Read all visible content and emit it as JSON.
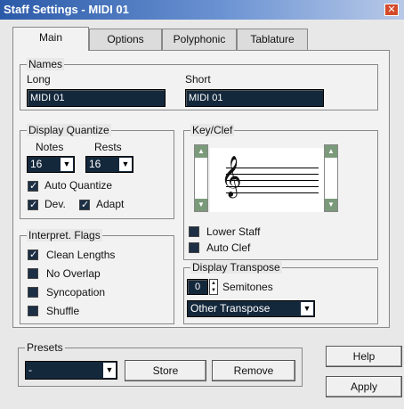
{
  "window": {
    "title": "Staff Settings - MIDI 01",
    "close_icon": "close-icon"
  },
  "tabs": [
    {
      "label": "Main",
      "active": true
    },
    {
      "label": "Options",
      "active": false
    },
    {
      "label": "Polyphonic",
      "active": false
    },
    {
      "label": "Tablature",
      "active": false
    }
  ],
  "names": {
    "label": "Names",
    "long_label": "Long",
    "long_value": "MIDI 01",
    "short_label": "Short",
    "short_value": "MIDI 01"
  },
  "display_quantize": {
    "label": "Display Quantize",
    "notes_label": "Notes",
    "notes_value": "16",
    "rests_label": "Rests",
    "rests_value": "16",
    "auto_quantize": {
      "label": "Auto Quantize",
      "checked": true
    },
    "dev": {
      "label": "Dev.",
      "checked": true
    },
    "adapt": {
      "label": "Adapt",
      "checked": true
    }
  },
  "key_clef": {
    "label": "Key/Clef",
    "lower_staff": {
      "label": "Lower Staff",
      "checked": false
    },
    "auto_clef": {
      "label": "Auto Clef",
      "checked": false
    }
  },
  "interpret_flags": {
    "label": "Interpret. Flags",
    "items": [
      {
        "label": "Clean Lengths",
        "checked": true
      },
      {
        "label": "No Overlap",
        "checked": false
      },
      {
        "label": "Syncopation",
        "checked": false
      },
      {
        "label": "Shuffle",
        "checked": false
      }
    ]
  },
  "display_transpose": {
    "label": "Display Transpose",
    "semitones_value": "0",
    "semitones_label": "Semitones",
    "other_transpose": "Other Transpose"
  },
  "presets": {
    "label": "Presets",
    "value": "-",
    "store_label": "Store",
    "remove_label": "Remove"
  },
  "footer": {
    "help_label": "Help",
    "apply_label": "Apply"
  },
  "colors": {
    "titlebar": "#2b5aa8",
    "field_bg": "#14283c"
  }
}
